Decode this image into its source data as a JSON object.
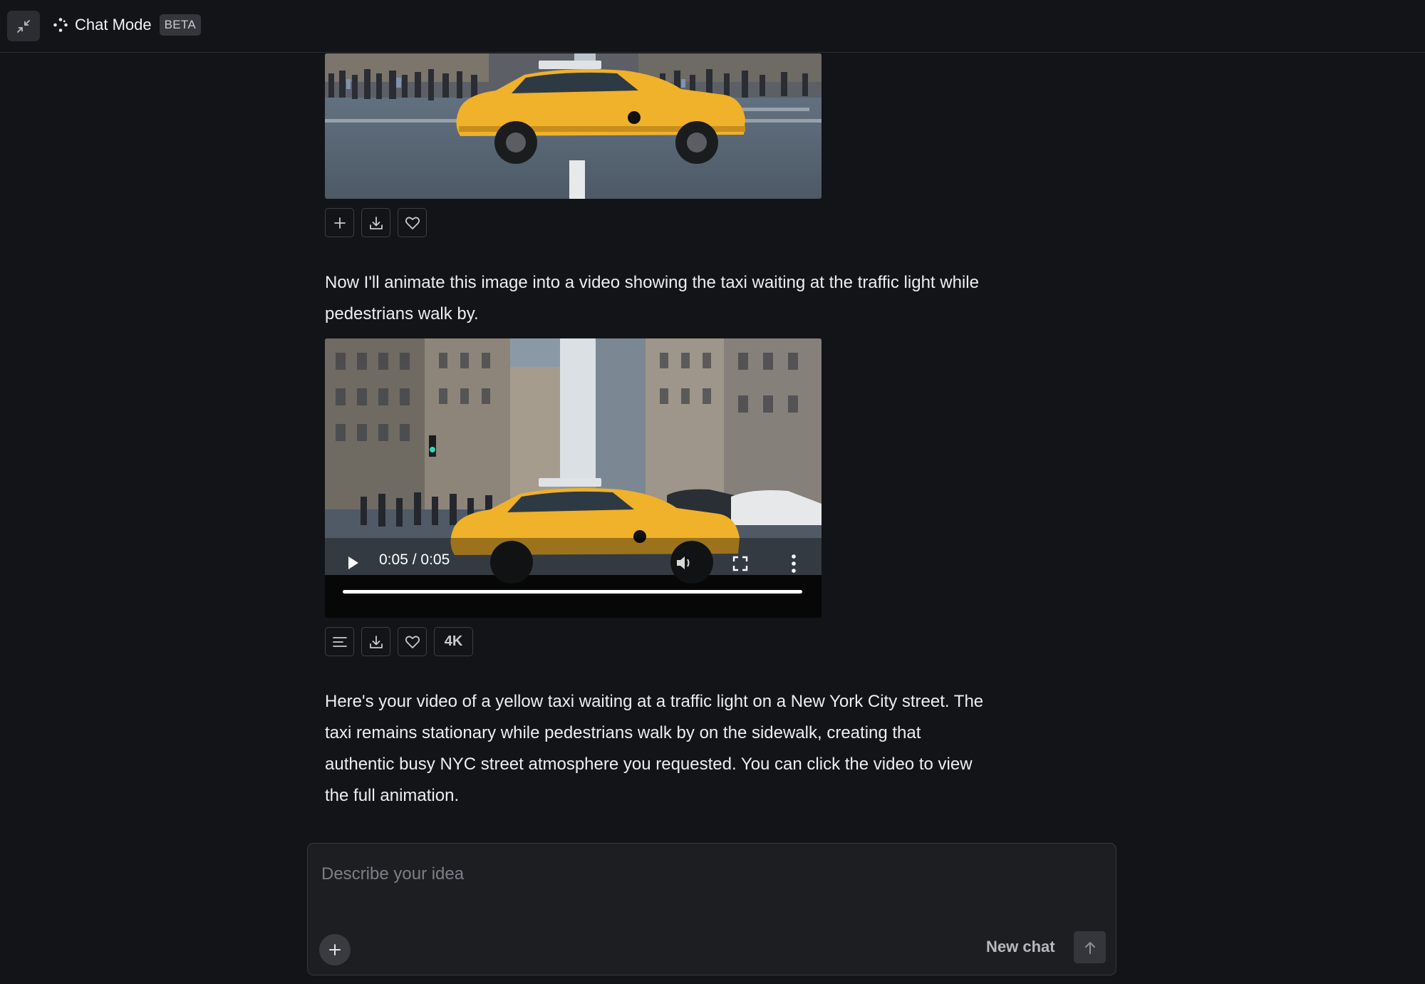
{
  "header": {
    "title": "Chat Mode",
    "badge": "BETA",
    "collapse_icon": "collapse-arrows-icon",
    "brand_icon": "sparkle-dots-icon"
  },
  "image_result": {
    "alt": "Yellow taxi on a busy New York City street",
    "actions": [
      {
        "icon": "plus-icon"
      },
      {
        "icon": "download-icon"
      },
      {
        "icon": "heart-icon"
      }
    ]
  },
  "messages": [
    {
      "text": "Now I'll animate this image into a video showing the taxi waiting at the traffic light while pedestrians walk by."
    },
    {
      "text": "Here's your video of a yellow taxi waiting at a traffic light on a New York City street. The taxi remains stationary while pedestrians walk by on the sidewalk, creating that authentic busy NYC street atmosphere you requested. You can click the video to view the full animation."
    }
  ],
  "video_result": {
    "time": "0:05 / 0:05",
    "progress": 1.0,
    "actions": [
      {
        "icon": "text-lines-icon"
      },
      {
        "icon": "download-icon"
      },
      {
        "icon": "heart-icon"
      },
      {
        "label": "4K"
      }
    ]
  },
  "composer": {
    "placeholder": "Describe your idea",
    "new_chat_label": "New chat"
  },
  "colors": {
    "background": "#131417",
    "taxi_yellow": "#f0b12b",
    "composer_bg": "#1d1e22"
  }
}
